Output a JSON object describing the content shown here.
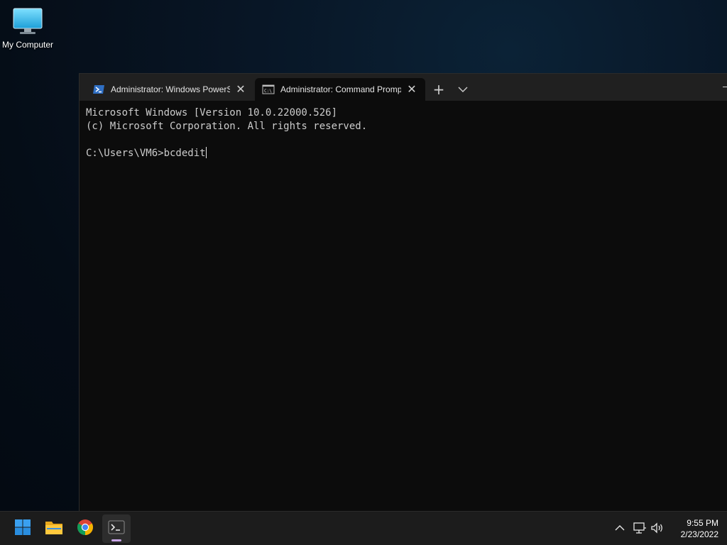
{
  "desktop": {
    "icons": [
      {
        "label": "My Computer",
        "icon": "monitor-icon"
      }
    ]
  },
  "terminal": {
    "tabs": [
      {
        "title": "Administrator: Windows PowerShell",
        "icon": "powershell-icon",
        "active": false
      },
      {
        "title": "Administrator: Command Prompt",
        "icon": "cmd-icon",
        "active": true
      }
    ],
    "new_tab_glyph": "+",
    "close_glyph": "✕",
    "console": {
      "line1": "Microsoft Windows [Version 10.0.22000.526]",
      "line2": "(c) Microsoft Corporation. All rights reserved.",
      "prompt": "C:\\Users\\VM6>",
      "input": "bcdedit"
    }
  },
  "taskbar": {
    "apps": [
      "windows-start-icon",
      "file-explorer-icon",
      "chrome-icon",
      "terminal-icon"
    ],
    "active_app": "terminal-icon",
    "clock": {
      "time": "9:55 PM",
      "date": "2/23/2022"
    }
  },
  "colors": {
    "terminal_bg": "#0c0c0c",
    "tabbar_bg": "#202020",
    "taskbar_bg": "#1c1c1c",
    "accent": "#0078d4"
  }
}
